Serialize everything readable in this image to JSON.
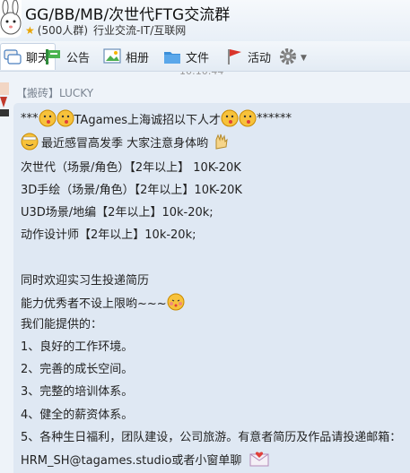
{
  "window": {
    "title": "GG/BB/MB/次世代FTG交流群",
    "member_count": "(500人群)",
    "category": "行业交流-IT/互联网"
  },
  "toolbar": {
    "tabs": [
      {
        "label": "聊天",
        "icon": "chat-icon",
        "active": true
      },
      {
        "label": "公告",
        "icon": "announcement-icon"
      },
      {
        "label": "相册",
        "icon": "album-icon"
      },
      {
        "label": "文件",
        "icon": "folder-icon"
      },
      {
        "label": "活动",
        "icon": "flag-icon"
      }
    ],
    "settings_icon": "gear-icon"
  },
  "chat": {
    "timestamp_partial": "10:10:44",
    "sender": "【搬砖】LUCKY",
    "lines": [
      {
        "pre": "***",
        "mid": "TAgames上海诚招以下人才",
        "post": "******"
      },
      {
        "text": "最近感冒高发季 大家注意身体哟"
      },
      {
        "text": "次世代（场景/角色）【2年以上】 10K-20K"
      },
      {
        "text": "3D手绘（场景/角色）【2年以上】10K-20K"
      },
      {
        "text": "U3D场景/地编【2年以上】10k-20k;"
      },
      {
        "text": "动作设计师【2年以上】10k-20k;"
      },
      {
        "text": "同时欢迎实习生投递简历"
      },
      {
        "text": "能力优秀者不设上限哟~~~"
      },
      {
        "text": "我们能提供的："
      },
      {
        "text": "1、良好的工作环境。"
      },
      {
        "text": "2、完善的成长空间。"
      },
      {
        "text": "3、完整的培训体系。"
      },
      {
        "text": "4、健全的薪资体系。"
      },
      {
        "text": "5、各种生日福利，团队建设，公司旅游。有意者简历及作品请投递邮箱："
      },
      {
        "text": "HRM_SH@tagames.studio或者小窗单聊"
      }
    ]
  },
  "colors": {
    "bubble": "#dfe8f3",
    "background": "#eef3f9",
    "star": "#e8a400",
    "flag": "#d9342b",
    "folder": "#3b8fd9"
  }
}
